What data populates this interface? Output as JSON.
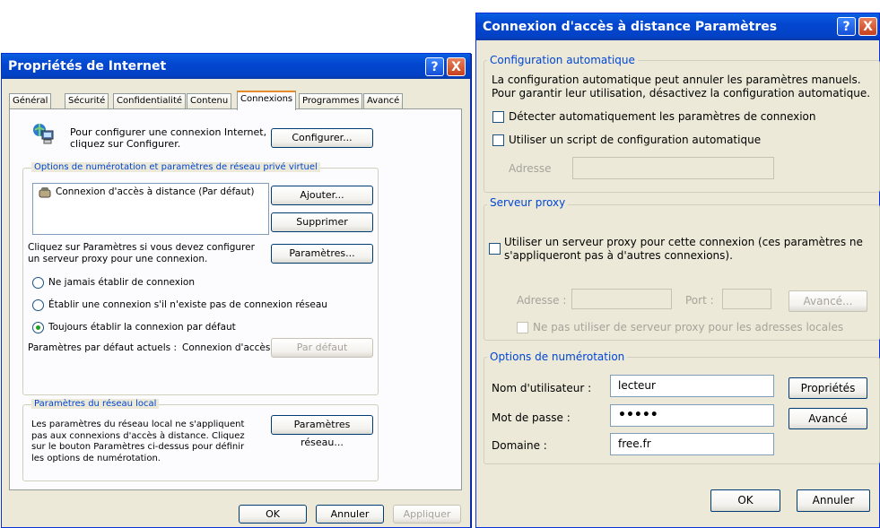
{
  "left_window": {
    "title": "Propriétés de Internet",
    "help": "?",
    "close": "X",
    "tabs": [
      {
        "label": "Général"
      },
      {
        "label": "Sécurité"
      },
      {
        "label": "Confidentialité"
      },
      {
        "label": "Contenu"
      },
      {
        "label": "Connexions"
      },
      {
        "label": "Programmes"
      },
      {
        "label": "Avancé"
      }
    ],
    "setup_text": "Pour configurer une connexion Internet, cliquez sur Configurer.",
    "configure_btn": "Configurer...",
    "dialup_group": "Options de numérotation et paramètres de réseau privé virtuel",
    "connection_item": "Connexion d'accès à distance (Par défaut)",
    "add_btn": "Ajouter...",
    "remove_btn": "Supprimer",
    "settings_text": "Cliquez sur Paramètres si vous devez configurer un serveur proxy pour une connexion.",
    "settings_btn": "Paramètres...",
    "radio_never": "Ne jamais établir de connexion",
    "radio_when_no_net": "Établir une connexion s'il n'existe pas de connexion réseau",
    "radio_always": "Toujours établir la connexion par défaut",
    "current_default_label": "Paramètres par défaut actuels :",
    "current_default_value": "Connexion d'accès",
    "set_default_btn": "Par défaut",
    "lan_group": "Paramètres du réseau local",
    "lan_text": "Les paramètres du réseau local ne s'appliquent pas aux connexions d'accès à distance. Cliquez sur le bouton Paramètres ci-dessus pour définir les options de numérotation.",
    "lan_btn": "Paramètres réseau...",
    "ok_btn": "OK",
    "cancel_btn": "Annuler",
    "apply_btn": "Appliquer"
  },
  "right_window": {
    "title": "Connexion d'accès à distance Paramètres",
    "help": "?",
    "close": "X",
    "auto_group": "Configuration automatique",
    "auto_text": "La configuration automatique peut annuler les paramètres manuels. Pour garantir leur utilisation, désactivez la configuration automatique.",
    "detect_label": "Détecter automatiquement les paramètres de connexion",
    "script_label": "Utiliser un script de configuration automatique",
    "address_label": "Adresse",
    "proxy_group": "Serveur proxy",
    "proxy_label": "Utiliser un serveur proxy pour cette connexion (ces paramètres ne s'appliqueront pas à d'autres connexions).",
    "proxy_address_label": "Adresse :",
    "port_label": "Port :",
    "advanced_proxy_btn": "Avancé...",
    "bypass_label": "Ne pas utiliser de serveur proxy pour les adresses locales",
    "dial_group": "Options de numérotation",
    "username_label": "Nom d'utilisateur :",
    "username_value": "lecteur",
    "password_label": "Mot de passe :",
    "password_value": "•••••",
    "domain_label": "Domaine :",
    "domain_value": "free.fr",
    "properties_btn": "Propriétés",
    "advanced_btn": "Avancé",
    "ok_btn": "OK",
    "cancel_btn": "Annuler"
  }
}
